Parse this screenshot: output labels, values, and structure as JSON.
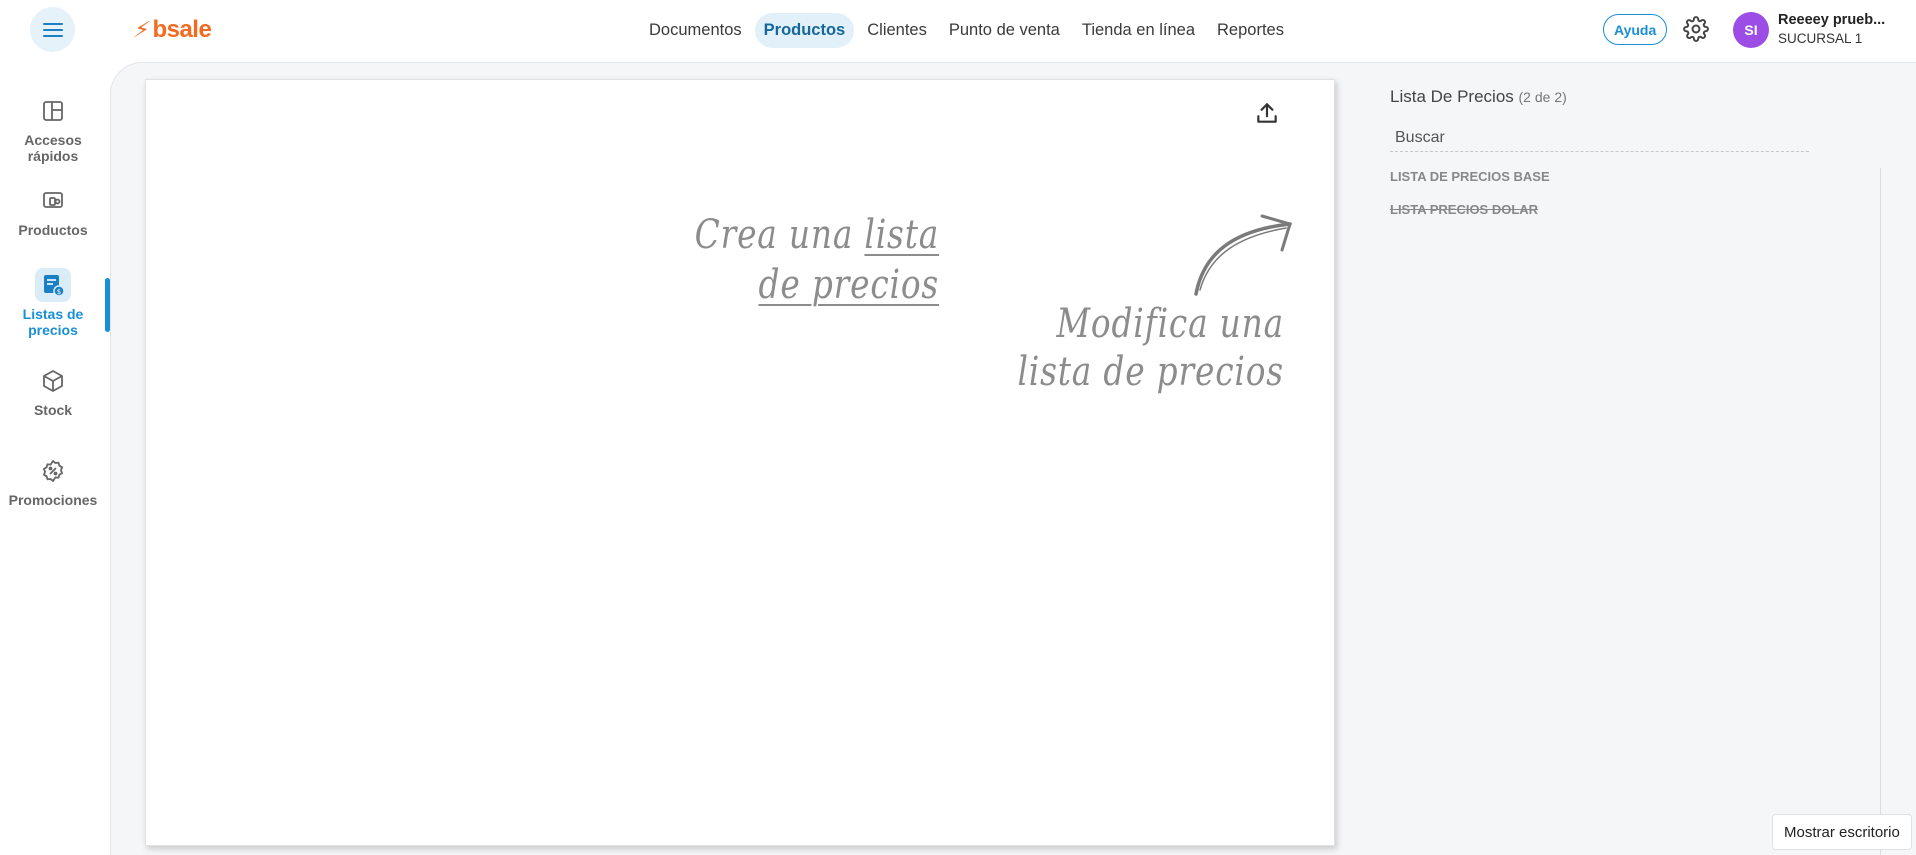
{
  "header": {
    "logo_text": "bsale",
    "nav": [
      {
        "label": "Documentos",
        "active": false
      },
      {
        "label": "Productos",
        "active": true
      },
      {
        "label": "Clientes",
        "active": false
      },
      {
        "label": "Punto de venta",
        "active": false
      },
      {
        "label": "Tienda en línea",
        "active": false
      },
      {
        "label": "Reportes",
        "active": false
      }
    ],
    "help_label": "Ayuda",
    "user": {
      "initials": "SI",
      "name": "Reeeey prueb...",
      "branch": "SUCURSAL 1"
    }
  },
  "sidebar": {
    "items": [
      {
        "label_line1": "Accesos",
        "label_line2": "rápidos",
        "icon": "layout-icon",
        "active": false
      },
      {
        "label_line1": "Productos",
        "label_line2": "",
        "icon": "devices-icon",
        "active": false
      },
      {
        "label_line1": "Listas de",
        "label_line2": "precios",
        "icon": "price-list-icon",
        "active": true
      },
      {
        "label_line1": "Stock",
        "label_line2": "",
        "icon": "box-icon",
        "active": false
      },
      {
        "label_line1": "Promociones",
        "label_line2": "",
        "icon": "discount-badge-icon",
        "active": false
      }
    ]
  },
  "canvas": {
    "hint_create": {
      "prefix": "Crea una ",
      "link1": "lista",
      "link2": "de precios"
    },
    "hint_modify": {
      "line1": "Modifica una",
      "line2": "lista de precios"
    }
  },
  "panel": {
    "title": "Lista De Precios",
    "count": "(2 de 2)",
    "search_placeholder": "Buscar",
    "items": [
      {
        "label": "LISTA DE PRECIOS BASE",
        "struck": false
      },
      {
        "label": "LISTA PRECIOS DOLAR",
        "struck": true
      }
    ]
  },
  "footer": {
    "desktop_label": "Mostrar escritorio"
  },
  "colors": {
    "brand_orange": "#f26b21",
    "accent_blue": "#1a8fd6",
    "avatar_purple": "#9b4de6"
  }
}
